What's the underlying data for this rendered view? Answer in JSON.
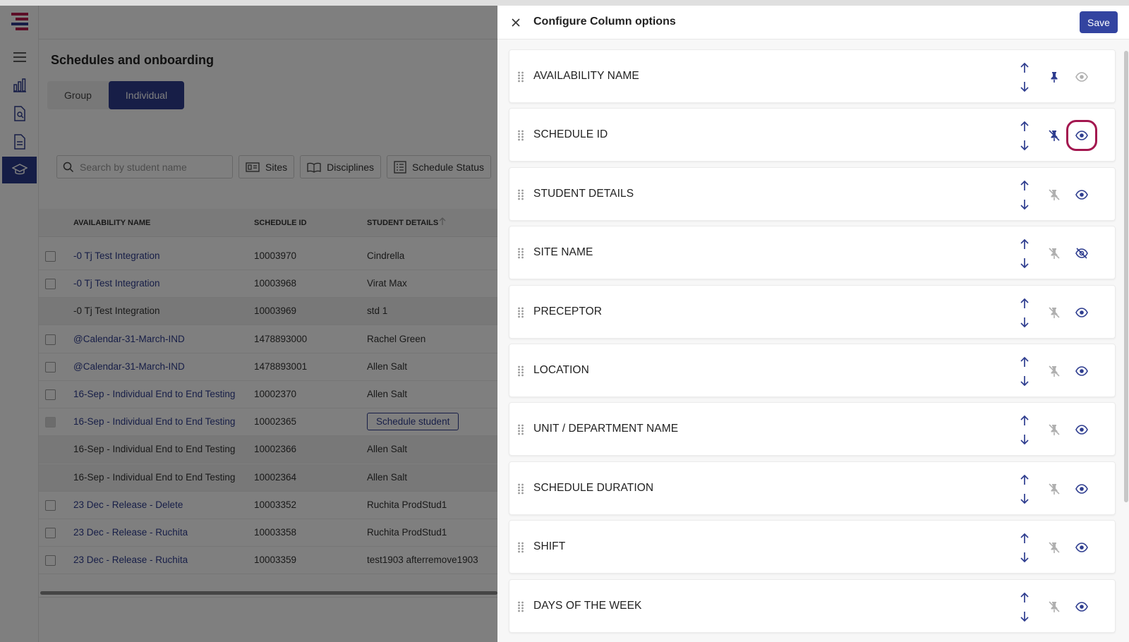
{
  "background": {
    "page_title": "Schedules and onboarding",
    "tabs": [
      {
        "label": "Group",
        "active": false
      },
      {
        "label": "Individual",
        "active": true
      }
    ],
    "search": {
      "placeholder": "Search by student name"
    },
    "filters": [
      "Sites",
      "Disciplines",
      "Schedule Status"
    ],
    "table": {
      "headers": [
        "AVAILABILITY NAME",
        "SCHEDULE ID",
        "STUDENT DETAILS"
      ],
      "rows": [
        {
          "name": "-0 Tj Test Integration",
          "id": "10003970",
          "student": "Cindrella",
          "link": true
        },
        {
          "name": "-0 Tj Test Integration",
          "id": "10003968",
          "student": "Virat Max",
          "link": true
        },
        {
          "name": "-0 Tj Test Integration",
          "id": "10003969",
          "student": "std 1",
          "link": false
        },
        {
          "name": "@Calendar-31-March-IND",
          "id": "1478893000",
          "student": "Rachel Green",
          "link": true
        },
        {
          "name": "@Calendar-31-March-IND",
          "id": "1478893001",
          "student": "Allen Salt",
          "link": true
        },
        {
          "name": "16-Sep - Individual End to End Testing",
          "id": "10002370",
          "student": "Allen Salt",
          "link": true
        },
        {
          "name": "16-Sep - Individual End to End Testing",
          "id": "10002365",
          "student": "Schedule student",
          "link": true,
          "button": true
        },
        {
          "name": "16-Sep - Individual End to End Testing",
          "id": "10002366",
          "student": "Allen Salt",
          "link": false
        },
        {
          "name": "16-Sep - Individual End to End Testing",
          "id": "10002364",
          "student": "Allen Salt",
          "link": false
        },
        {
          "name": "23 Dec - Release - Delete",
          "id": "10003352",
          "student": "Ruchita ProdStud1",
          "link": true
        },
        {
          "name": "23 Dec - Release - Ruchita",
          "id": "10003358",
          "student": "Ruchita ProdStud1",
          "link": true
        },
        {
          "name": "23 Dec - Release - Ruchita",
          "id": "10003359",
          "student": "test1903 afterremove1903",
          "link": true
        }
      ]
    }
  },
  "drawer": {
    "title": "Configure Column options",
    "save_label": "Save",
    "columns": [
      {
        "label": "AVAILABILITY NAME",
        "pinned": true,
        "visible": true,
        "locked": true
      },
      {
        "label": "SCHEDULE ID",
        "pinned": false,
        "visible": true,
        "highlighted": true
      },
      {
        "label": "STUDENT DETAILS",
        "pinned": false,
        "visible": true
      },
      {
        "label": "SITE NAME",
        "pinned": false,
        "visible": false
      },
      {
        "label": "PRECEPTOR",
        "pinned": false,
        "visible": true
      },
      {
        "label": "LOCATION",
        "pinned": false,
        "visible": true
      },
      {
        "label": "UNIT / DEPARTMENT NAME",
        "pinned": false,
        "visible": true
      },
      {
        "label": "SCHEDULE DURATION",
        "pinned": false,
        "visible": true
      },
      {
        "label": "SHIFT",
        "pinned": false,
        "visible": true
      },
      {
        "label": "DAYS OF THE WEEK",
        "pinned": false,
        "visible": true
      }
    ]
  },
  "colors": {
    "primary": "#2e3d8f",
    "save_button": "#3344a0",
    "icon_active": "#2e3d8f",
    "icon_muted": "#b0b0b0",
    "highlight_box": "#a3174f"
  },
  "icons": {
    "drawer": [
      "close-icon",
      "drag-handle-icon",
      "arrow-up-icon",
      "arrow-down-icon",
      "pin-icon",
      "pin-off-icon",
      "eye-icon",
      "eye-off-icon"
    ],
    "rail": [
      "menu-icon",
      "bar-chart-icon",
      "search-document-icon",
      "document-icon",
      "graduation-cap-icon"
    ],
    "filters": [
      "search-icon",
      "sites-icon",
      "book-icon",
      "list-icon"
    ]
  }
}
